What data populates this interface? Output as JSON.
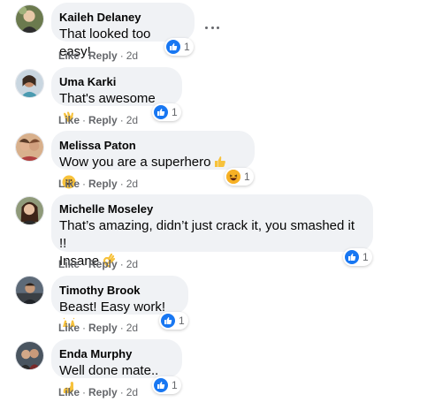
{
  "comments": [
    {
      "author": "Kaileh Delaney",
      "text": "That looked too easy!",
      "like": "Like",
      "reply": "Reply",
      "time": "2d",
      "reaction_count": "1"
    },
    {
      "author": "Uma Karki",
      "text": "That's awesome",
      "like": "Like",
      "reply": "Reply",
      "time": "2d",
      "reaction_count": "1"
    },
    {
      "author": "Melissa Paton",
      "text": "Wow you are a superhero",
      "like": "Like",
      "reply": "Reply",
      "time": "2d",
      "reaction_count": "1"
    },
    {
      "author": "Michelle Moseley",
      "text": "That’s amazing, didn’t just crack it, you smashed it !!",
      "text2": "Insane",
      "like": "Like",
      "reply": "Reply",
      "time": "2d",
      "reaction_count": "1"
    },
    {
      "author": "Timothy Brook",
      "text": "Beast! Easy work!",
      "like": "Like",
      "reply": "Reply",
      "time": "2d",
      "reaction_count": "1"
    },
    {
      "author": "Enda Murphy",
      "text": "Well done mate..",
      "like": "Like",
      "reply": "Reply",
      "time": "2d",
      "reaction_count": "1"
    }
  ],
  "icons": {
    "like_reaction": "thumbs-up-icon",
    "haha_reaction": "laughing-face-icon",
    "more_options": "more-options-icon"
  },
  "colors": {
    "bubble": "#f0f2f5",
    "like_blue": "#1877f2",
    "secondary_text": "#65676b"
  }
}
